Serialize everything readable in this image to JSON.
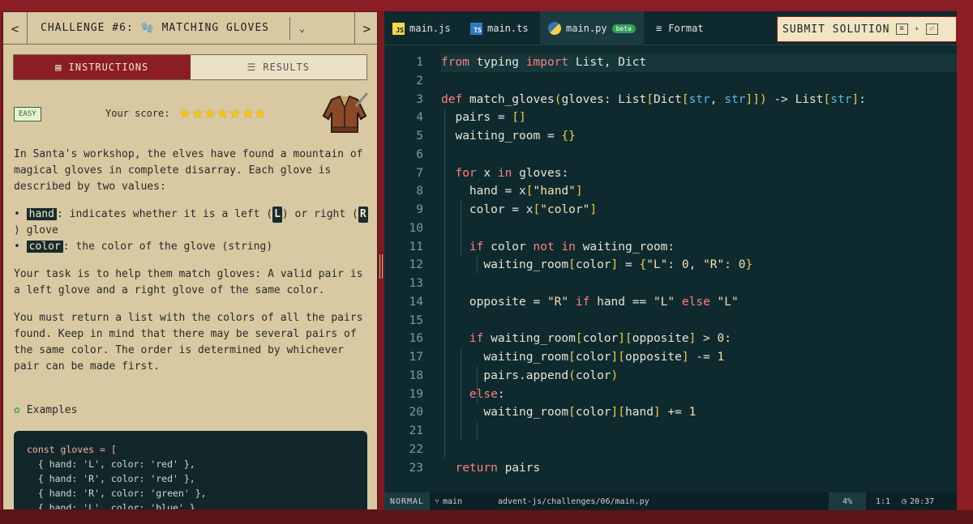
{
  "challenge": {
    "prev": "<",
    "next": ">",
    "title": "CHALLENGE #6: 🧤 MATCHING GLOVES",
    "dropdown": "⌄"
  },
  "tabs": {
    "instructions": "INSTRUCTIONS",
    "results": "RESULTS"
  },
  "difficulty": "EASY",
  "score_label": "Your score:",
  "stars": 7,
  "description": {
    "p1": "In Santa's workshop, the elves have found a mountain of magical gloves in complete disarray. Each glove is described by two values:",
    "hand_key": "hand",
    "hand_text_1": ": indicates whether it is a left (",
    "hand_L": "L",
    "hand_text_2": ") or right (",
    "hand_R": "R",
    "hand_text_3": ") glove",
    "color_key": "color",
    "color_text": ": the color of the glove (string)",
    "p2": "Your task is to help them match gloves: A valid pair is a left glove and a right glove of the same color.",
    "p3": "You must return a list with the colors of all the pairs found. Keep in mind that there may be several pairs of the same color. The order is determined by whichever pair can be made first."
  },
  "examples_label": "Examples",
  "example_code": [
    "const gloves = [",
    "  { hand: 'L', color: 'red' },",
    "  { hand: 'R', color: 'red' },",
    "  { hand: 'R', color: 'green' },",
    "  { hand: 'L', color: 'blue' },"
  ],
  "file_tabs": [
    {
      "label": "main.js",
      "badge": "JS"
    },
    {
      "label": "main.ts",
      "badge": "TS"
    },
    {
      "label": "main.py",
      "badge": "PY",
      "extra": "beta"
    }
  ],
  "format_label": "Format",
  "submit": {
    "label": "SUBMIT SOLUTION",
    "key1": "⌘",
    "plus": "+",
    "key2": "⏎"
  },
  "line_numbers": [
    "1",
    "2",
    "3",
    "4",
    "5",
    "6",
    "7",
    "8",
    "9",
    "10",
    "11",
    "12",
    "13",
    "14",
    "15",
    "16",
    "17",
    "18",
    "19",
    "20",
    "21",
    "22",
    "23"
  ],
  "status": {
    "mode": "NORMAL",
    "branch": "main",
    "path": "advent-js/challenges/06/main.py",
    "percent": "4%",
    "position": "1:1",
    "time": "20:37"
  },
  "colors": {
    "accent_red": "#8b1d24",
    "editor_bg": "#0f2a2e",
    "panel_bg": "#d8c9a3"
  }
}
